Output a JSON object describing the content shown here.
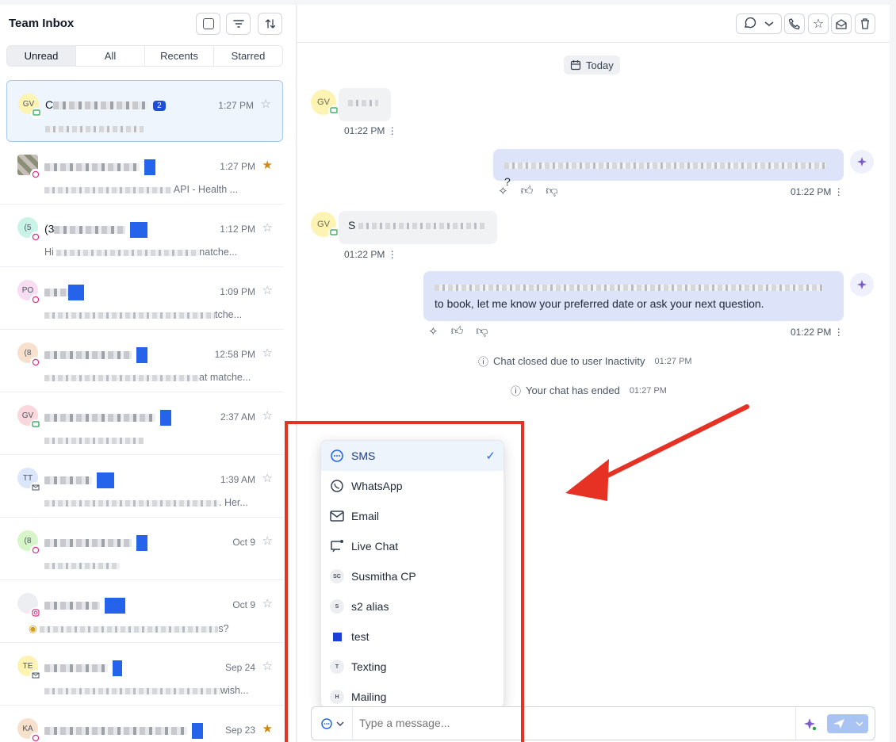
{
  "left_panel": {
    "title": "Team Inbox",
    "tabs": [
      "Unread",
      "All",
      "Recents",
      "Starred"
    ],
    "conversations": [
      {
        "initials": "GV",
        "avatar_color": "#fdf3b3",
        "channel": "sms",
        "name_prefix": "C",
        "unread": "2",
        "time": "1:27 PM",
        "starred": false,
        "preview": ""
      },
      {
        "initials": "",
        "avatar_color": "#8b8f75",
        "channel": "chat",
        "name_prefix": "",
        "time": "1:27 PM",
        "starred": true,
        "preview": "API - Health ..."
      },
      {
        "initials": "(5",
        "avatar_color": "#c9f3e6",
        "channel": "chat",
        "name_prefix": "(3",
        "time": "1:12 PM",
        "starred": false,
        "preview": "Hi",
        "preview_suffix": "natche..."
      },
      {
        "initials": "PO",
        "avatar_color": "#f7dcf2",
        "channel": "chat",
        "name_prefix": "",
        "time": "1:09 PM",
        "starred": false,
        "preview": "",
        "preview_suffix": "tche..."
      },
      {
        "initials": "(8",
        "avatar_color": "#f7e1cc",
        "channel": "chat",
        "name_prefix": "",
        "time": "12:58 PM",
        "starred": false,
        "preview": "",
        "preview_suffix": "at matche..."
      },
      {
        "initials": "GV",
        "avatar_color": "#f9d7dc",
        "channel": "sms",
        "name_prefix": "",
        "time": "2:37 AM",
        "starred": false,
        "preview": ""
      },
      {
        "initials": "TT",
        "avatar_color": "#dbe6fb",
        "channel": "email",
        "name_prefix": "",
        "time": "1:39 AM",
        "starred": false,
        "preview": "",
        "preview_suffix": ". Her..."
      },
      {
        "initials": "(8",
        "avatar_color": "#d8f4c9",
        "channel": "chat",
        "name_prefix": "",
        "time": "Oct 9",
        "starred": false,
        "preview": ""
      },
      {
        "initials": "",
        "avatar_color": "#eceef1",
        "channel": "instagram",
        "name_prefix": "",
        "time": "Oct 9",
        "starred": false,
        "preview": "",
        "preview_suffix": "s?"
      },
      {
        "initials": "TE",
        "avatar_color": "#fdf3b3",
        "channel": "email",
        "name_prefix": "",
        "time": "Sep 24",
        "starred": false,
        "preview": "",
        "preview_suffix": "wish..."
      },
      {
        "initials": "KA",
        "avatar_color": "#f7e1cc",
        "channel": "chat",
        "name_prefix": "",
        "time": "Sep 23",
        "starred": true,
        "preview": ""
      }
    ]
  },
  "chat": {
    "date_label": "Today",
    "messages": [
      {
        "dir": "in",
        "initials": "GV",
        "text": "",
        "time": "01:22 PM"
      },
      {
        "dir": "out",
        "text": "?",
        "time": "01:22 PM"
      },
      {
        "dir": "in",
        "initials": "GV",
        "text": "S",
        "time": "01:22 PM"
      },
      {
        "dir": "out",
        "text_line2": "to book, let me know your preferred date or ask your next question.",
        "time": "01:22 PM"
      }
    ],
    "system": [
      {
        "text": "Chat closed due to user Inactivity",
        "time": "01:27 PM"
      },
      {
        "text": "Your chat has ended",
        "time": "01:27 PM"
      }
    ]
  },
  "channel_dropdown": {
    "items": [
      {
        "label": "SMS",
        "icon": "sms-icon",
        "selected": true
      },
      {
        "label": "WhatsApp",
        "icon": "whatsapp-icon",
        "selected": false
      },
      {
        "label": "Email",
        "icon": "email-icon",
        "selected": false
      },
      {
        "label": "Live Chat",
        "icon": "live-chat-icon",
        "selected": false
      },
      {
        "label": "Susmitha CP",
        "icon": "avatar",
        "badge": "SC",
        "selected": false
      },
      {
        "label": "s2 alias",
        "icon": "avatar",
        "badge": "S",
        "selected": false
      },
      {
        "label": "test",
        "icon": "blue-square",
        "selected": false
      },
      {
        "label": "Texting",
        "icon": "avatar",
        "badge": "T",
        "selected": false
      },
      {
        "label": "Mailing",
        "icon": "avatar",
        "badge": "H",
        "selected": false
      }
    ]
  },
  "composer": {
    "placeholder": "Type a message..."
  },
  "colors": {
    "accent": "#2563eb",
    "annotation_red": "#e53225",
    "outgoing_bubble": "#dde3f8",
    "star_on": "#d4880e"
  }
}
